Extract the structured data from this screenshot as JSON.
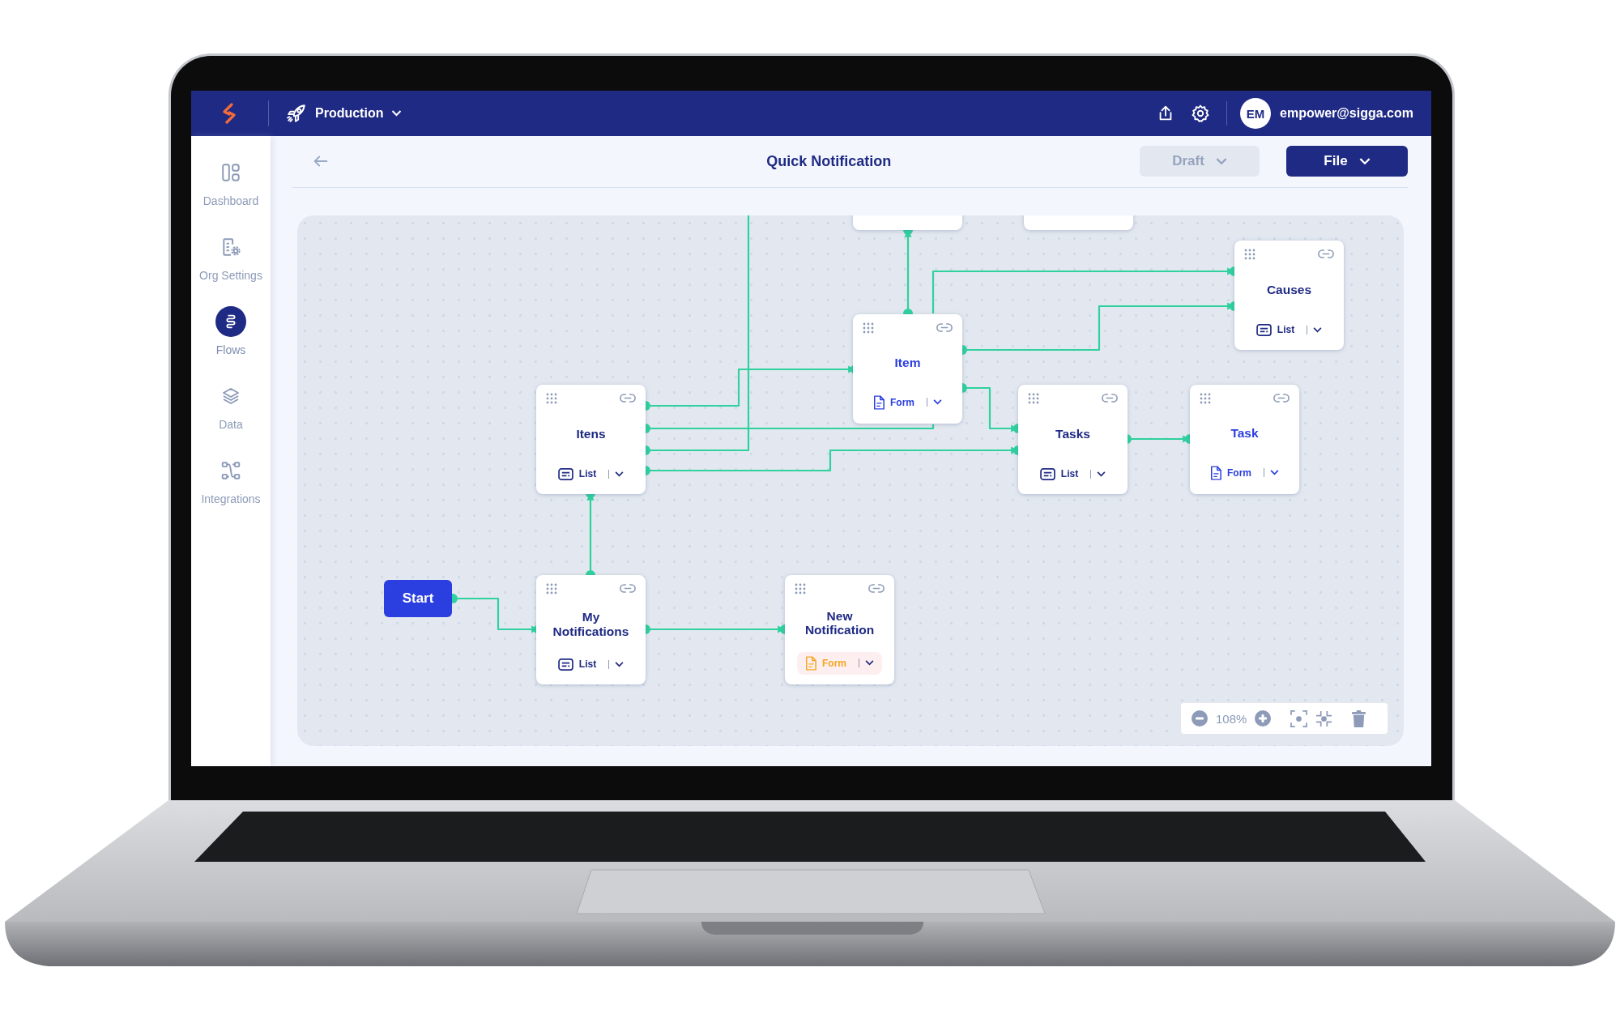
{
  "app_bar": {
    "environment": "Production",
    "user_initials": "EM",
    "user_email": "empower@sigga.com"
  },
  "sidebar": {
    "items": [
      {
        "label": "Dashboard",
        "selected": false
      },
      {
        "label": "Org Settings",
        "selected": false
      },
      {
        "label": "Flows",
        "selected": true
      },
      {
        "label": "Data",
        "selected": false
      },
      {
        "label": "Integrations",
        "selected": false
      }
    ]
  },
  "header": {
    "title": "Quick Notification",
    "buttons": [
      {
        "label": "Draft",
        "kind": "secondary"
      },
      {
        "label": "File",
        "kind": "primary"
      }
    ]
  },
  "canvas": {
    "start": "Start",
    "zoom": "108%",
    "nodes": [
      {
        "title": "Causes",
        "kind": "list",
        "type_label": "List",
        "highlighted": false,
        "alert": false
      },
      {
        "title": "Item",
        "kind": "form",
        "type_label": "Form",
        "highlighted": true,
        "alert": false
      },
      {
        "title": "Itens",
        "kind": "list",
        "type_label": "List",
        "highlighted": false,
        "alert": false
      },
      {
        "title": "Tasks",
        "kind": "list",
        "type_label": "List",
        "highlighted": false,
        "alert": false
      },
      {
        "title": "Task",
        "kind": "form",
        "type_label": "Form",
        "highlighted": true,
        "alert": false
      },
      {
        "title": "My Notifications",
        "kind": "list",
        "type_label": "List",
        "highlighted": false,
        "alert": false
      },
      {
        "title": "New Notification",
        "kind": "form",
        "type_label": "Form",
        "highlighted": false,
        "alert": true
      }
    ]
  }
}
